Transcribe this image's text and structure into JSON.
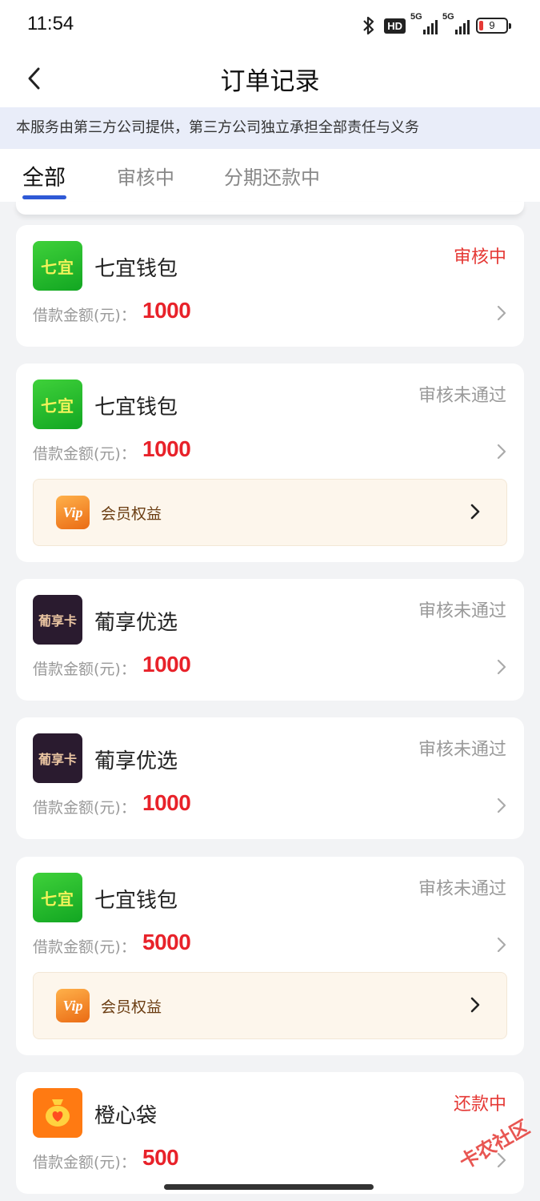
{
  "status_bar": {
    "time": "11:54",
    "hd": "HD",
    "net1": "5G",
    "net2": "5G",
    "battery": "9"
  },
  "nav": {
    "title": "订单记录"
  },
  "notice": "本服务由第三方公司提供，第三方公司独立承担全部责任与义务",
  "tabs": [
    {
      "label": "全部",
      "active": true
    },
    {
      "label": "审核中",
      "active": false
    },
    {
      "label": "分期还款中",
      "active": false
    }
  ],
  "amount_label": "借款金额(元)：",
  "vip_label": "会员权益",
  "vip_icon_text": "Vip",
  "orders": [
    {
      "name": "七宜钱包",
      "logo": "七宜",
      "logo_type": "qiyi",
      "status": "审核中",
      "status_color": "#e53935",
      "amount": "1000",
      "vip": false
    },
    {
      "name": "七宜钱包",
      "logo": "七宜",
      "logo_type": "qiyi",
      "status": "审核未通过",
      "status_color": "#9a9a9a",
      "amount": "1000",
      "vip": true
    },
    {
      "name": "葡享优选",
      "logo": "葡享卡",
      "logo_type": "putao",
      "status": "审核未通过",
      "status_color": "#9a9a9a",
      "amount": "1000",
      "vip": false
    },
    {
      "name": "葡享优选",
      "logo": "葡享卡",
      "logo_type": "putao",
      "status": "审核未通过",
      "status_color": "#9a9a9a",
      "amount": "1000",
      "vip": false
    },
    {
      "name": "七宜钱包",
      "logo": "七宜",
      "logo_type": "qiyi",
      "status": "审核未通过",
      "status_color": "#9a9a9a",
      "amount": "5000",
      "vip": true
    },
    {
      "name": "橙心袋",
      "logo": "",
      "logo_type": "chengxin",
      "status": "还款中",
      "status_color": "#e53935",
      "amount": "500",
      "vip": false
    }
  ],
  "watermark": "卡农社区",
  "colors": {
    "accent": "#2f59d6",
    "amount_red": "#e8222a",
    "status_red": "#e53935",
    "status_gray": "#9a9a9a"
  }
}
